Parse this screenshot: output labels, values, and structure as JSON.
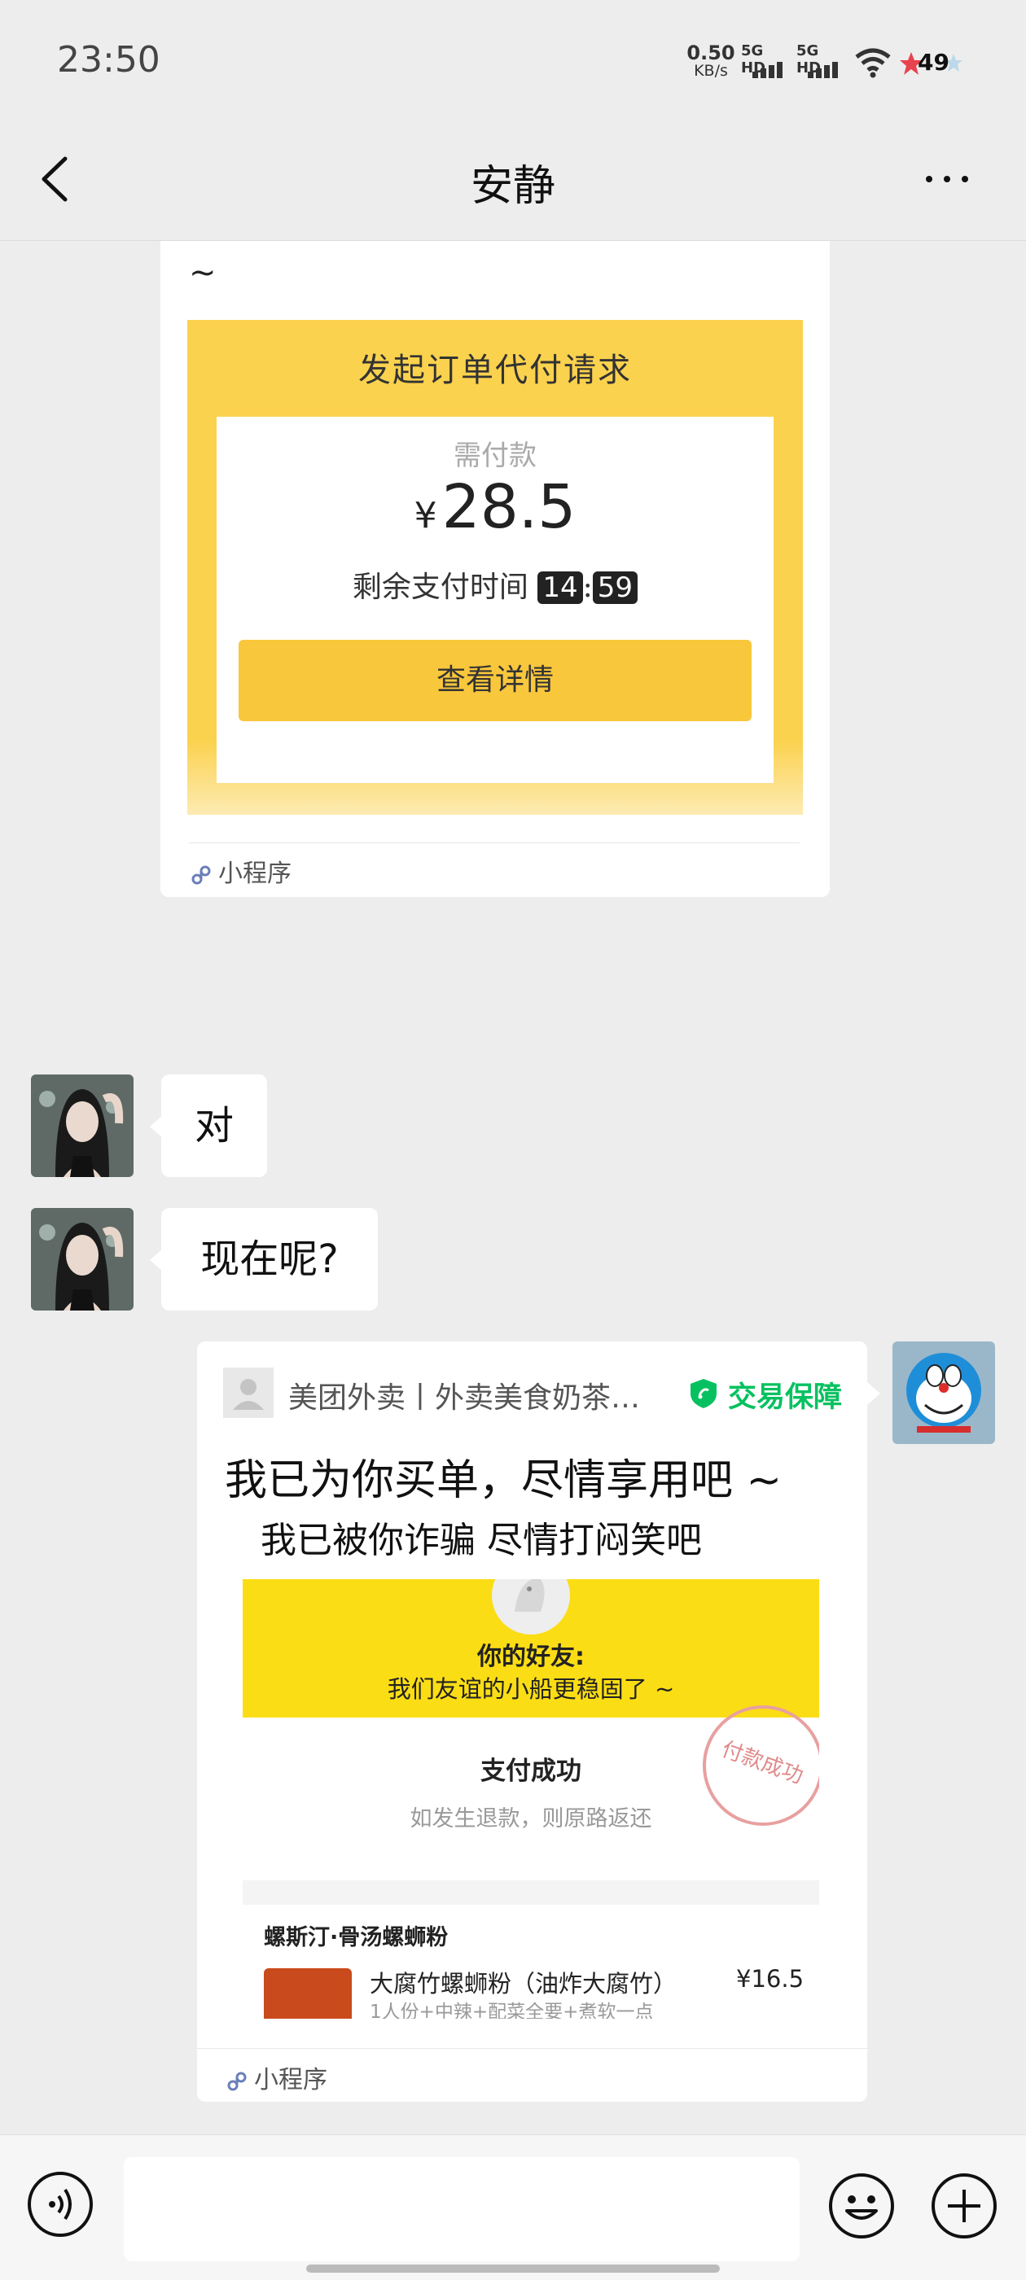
{
  "status_bar": {
    "time": "23:50",
    "net_speed": "0.50",
    "net_unit": "KB/s",
    "sim1": "5G HD",
    "sim2": "5G HD",
    "battery": "49"
  },
  "nav": {
    "title": "安静",
    "back_icon": "chevron-left-icon",
    "more_icon": "more-icon"
  },
  "card_pay_request": {
    "tilde": "~",
    "title": "发起订单代付请求",
    "need_pay_label": "需付款",
    "currency": "¥",
    "amount": "28.5",
    "remaining_label": "剩余支付时间",
    "remaining_minutes": "14",
    "separator": ":",
    "remaining_seconds": "59",
    "button": "查看详情",
    "source": "小程序"
  },
  "messages": [
    {
      "text": "对"
    },
    {
      "text": "现在呢?"
    }
  ],
  "card_meituan": {
    "source_name": "美团外卖丨外卖美食奶茶…",
    "guarantee": "交易保障",
    "main_text": "我已为你买单，尽情享用吧 ~",
    "sub_text": "我已被你诈骗 尽情打闷笑吧",
    "screenshot": {
      "friend_label": "你的好友:",
      "friend_msg": "我们友谊的小船更稳固了 ~",
      "pay_success": "支付成功",
      "refund_note": "如发生退款，则原路返还",
      "stamp": "付款成功",
      "shop": "螺斯汀·骨汤螺蛳粉",
      "item": "大腐竹螺蛳粉（油炸大腐竹）",
      "price": "¥16.5",
      "spec": "1人份+中辣+配菜全要+煮软一点"
    },
    "source": "小程序"
  },
  "colors": {
    "background": "#ededed",
    "pay_yellow": "#fbd24e",
    "button_yellow": "#f9c73c",
    "guarantee_green": "#07c160",
    "meituan_yellow": "#fbdd15"
  },
  "bottom_bar": {
    "voice_icon": "voice-icon",
    "emoji_icon": "emoji-icon",
    "plus_icon": "plus-icon",
    "input_placeholder": ""
  }
}
